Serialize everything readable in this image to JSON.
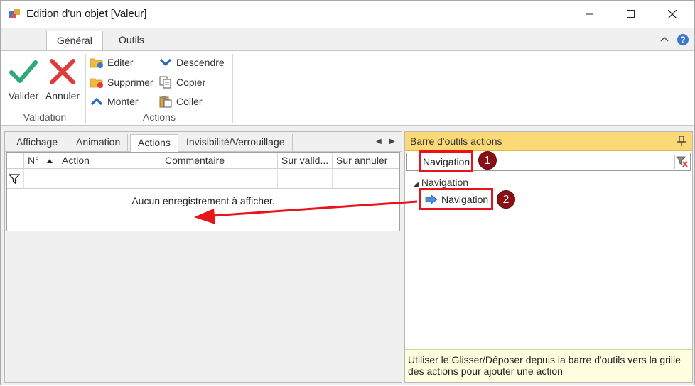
{
  "window": {
    "title": "Edition d'un objet [Valeur]",
    "controls": [
      "minimize",
      "maximize",
      "close"
    ]
  },
  "ribbon": {
    "tabs": [
      {
        "label": "Général",
        "active": true
      },
      {
        "label": "Outils",
        "active": false
      }
    ],
    "groups": {
      "validation": {
        "label": "Validation",
        "valider": "Valider",
        "annuler": "Annuler"
      },
      "actions": {
        "label": "Actions",
        "editer": "Editer",
        "supprimer": "Supprimer",
        "monter": "Monter",
        "descendre": "Descendre",
        "copier": "Copier",
        "coller": "Coller"
      }
    }
  },
  "left_panel": {
    "tabs": [
      "Affichage",
      "Animation",
      "Actions",
      "Invisibilité/Verrouillage"
    ],
    "active_tab": "Actions",
    "columns": [
      "N°",
      "Action",
      "Commentaire",
      "Sur valid...",
      "Sur annuler"
    ],
    "empty_message": "Aucun enregistrement à afficher."
  },
  "right_panel": {
    "title": "Barre d'outils actions",
    "search_value": "Navigation",
    "tree_group": "Navigation",
    "tree_item": "Navigation",
    "footer": "Utiliser le Glisser/Déposer depuis la barre d'outils vers la grille des actions pour ajouter une action"
  },
  "annotations": {
    "step1": "1",
    "step2": "2"
  },
  "colors": {
    "accent_header": "#fbd976",
    "annotation_red": "#e8141b",
    "badge": "#8b1013",
    "check_green": "#2eaa7a",
    "cross_red": "#e03a3a",
    "arrow_blue": "#1f6fd0"
  }
}
